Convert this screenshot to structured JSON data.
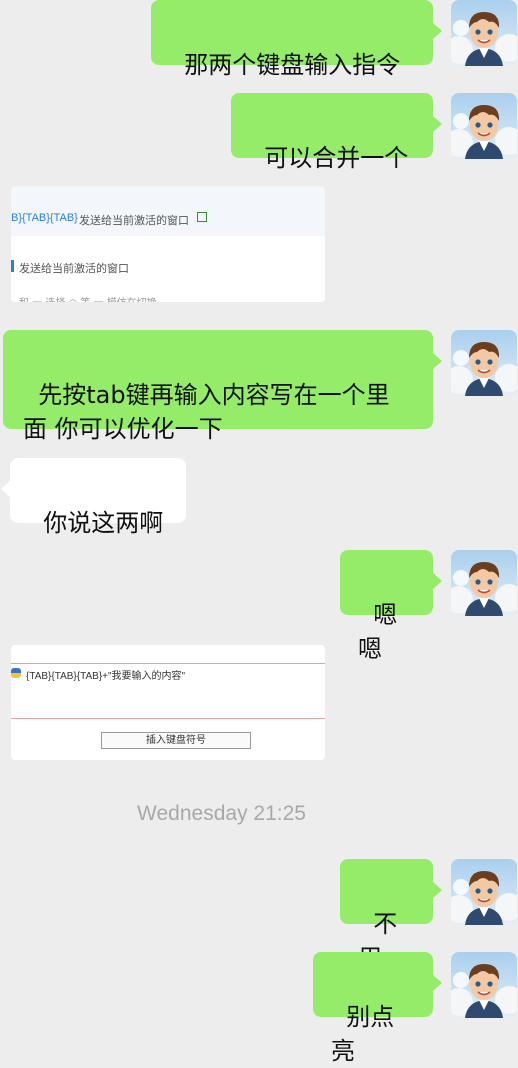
{
  "messages": [
    {
      "text": "那两个键盘输入指令"
    },
    {
      "text": "可以合并一个"
    },
    {
      "text": "先按tab键再输入内容写在一个里面 你可以优化一下"
    },
    {
      "text": "你说这两啊"
    },
    {
      "text": "嗯嗯"
    },
    {
      "text": "不用"
    },
    {
      "text": "别点亮"
    }
  ],
  "image1": {
    "line1_code": "B}{TAB}{TAB}",
    "line1_desc": "发送给当前激活的窗口",
    "line2_desc": "发送给当前激活的窗口",
    "line3_partial": "和 一 选择 ○ 等 一 模仿在切换"
  },
  "image2": {
    "code_line": "{TAB}{TAB}{TAB}+\"我要输入的内容\"",
    "button_label": "插入键盘符号"
  },
  "timestamp": "Wednesday 21:25",
  "colors": {
    "background": "#ededed",
    "my_bubble": "#95ec69",
    "other_bubble": "#ffffff"
  }
}
